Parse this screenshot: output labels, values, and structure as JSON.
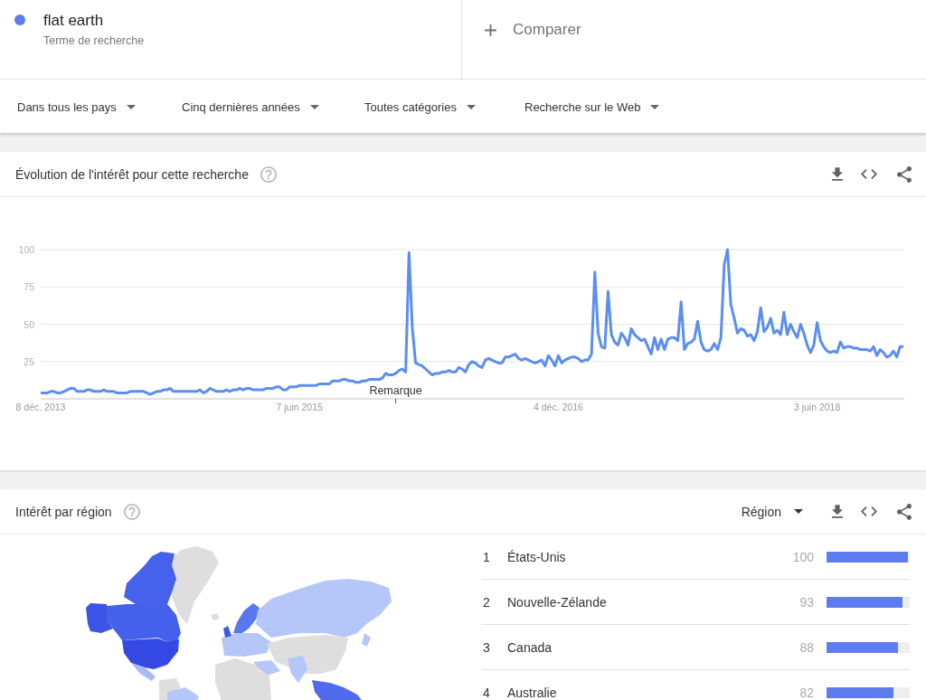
{
  "search_term": {
    "term": "flat earth",
    "caption": "Terme de recherche"
  },
  "compare": {
    "label": "Comparer"
  },
  "filters": [
    "Dans tous les pays",
    "Cinq dernières années",
    "Toutes catégories",
    "Recherche sur le Web"
  ],
  "interest_over_time": {
    "title": "Évolution de l'intérêt pour cette recherche",
    "chart_data": {
      "type": "line",
      "categories": [
        "8 déc. 2013",
        null,
        null,
        null,
        null,
        null,
        null,
        null,
        null,
        null,
        null,
        null,
        null,
        null,
        null,
        null,
        null,
        null,
        null,
        null,
        null,
        null,
        null,
        null,
        null,
        null,
        null,
        null,
        null,
        null,
        null,
        null,
        null,
        null,
        null,
        null,
        null,
        null,
        null,
        null,
        null,
        null,
        null,
        null,
        null,
        null,
        null,
        null,
        null,
        null,
        null,
        null,
        null,
        null,
        null,
        null,
        null,
        null,
        null,
        null,
        null,
        null,
        null,
        null,
        null,
        null,
        null,
        null,
        null,
        null,
        null,
        null,
        null,
        null,
        null,
        null,
        null,
        null,
        "7 juin 2015",
        null,
        null,
        null,
        null,
        null,
        null,
        null,
        null,
        null,
        null,
        null,
        null,
        null,
        null,
        null,
        null,
        null,
        null,
        null,
        null,
        null,
        null,
        null,
        null,
        null,
        null,
        null,
        null,
        null,
        null,
        null,
        null,
        null,
        null,
        null,
        null,
        null,
        null,
        null,
        null,
        null,
        null,
        null,
        null,
        null,
        null,
        null,
        null,
        null,
        null,
        null,
        null,
        null,
        null,
        null,
        null,
        null,
        null,
        null,
        null,
        null,
        null,
        null,
        null,
        null,
        null,
        null,
        null,
        null,
        null,
        null,
        null,
        null,
        null,
        null,
        null,
        null,
        "4 déc. 2016",
        null,
        null,
        null,
        null,
        null,
        null,
        null,
        null,
        null,
        null,
        null,
        null,
        null,
        null,
        null,
        null,
        null,
        null,
        null,
        null,
        null,
        null,
        null,
        null,
        null,
        null,
        null,
        null,
        null,
        null,
        null,
        null,
        null,
        null,
        null,
        null,
        null,
        null,
        null,
        null,
        null,
        null,
        null,
        null,
        null,
        null,
        null,
        null,
        null,
        null,
        null,
        null,
        null,
        null,
        null,
        null,
        null,
        null,
        null,
        null,
        null,
        null,
        null,
        null,
        null,
        null,
        null,
        null,
        null,
        null,
        null,
        null,
        null,
        null,
        null,
        null,
        null,
        "3 juin 2018",
        null,
        null,
        null,
        null,
        null,
        null,
        null,
        null,
        null,
        null,
        null,
        null,
        null,
        null,
        null,
        null,
        null,
        null,
        null,
        null,
        null,
        null,
        null,
        null,
        null,
        null
      ],
      "series": [
        {
          "color": "#5b8ef1",
          "values": [
            4,
            4,
            4,
            5,
            5,
            4,
            4,
            5,
            6,
            7,
            7,
            5,
            5,
            5,
            6,
            6,
            5,
            5,
            5,
            6,
            5,
            5,
            5,
            4,
            4,
            4,
            4,
            5,
            5,
            5,
            5,
            5,
            4,
            3,
            4,
            5,
            5,
            6,
            6,
            7,
            5,
            5,
            5,
            5,
            5,
            5,
            5,
            5,
            6,
            4,
            5,
            7,
            6,
            5,
            5,
            5,
            6,
            5,
            6,
            6,
            7,
            6,
            7,
            7,
            6,
            6,
            6,
            6,
            7,
            7,
            7,
            8,
            8,
            6,
            6,
            8,
            8,
            8,
            9,
            9,
            9,
            9,
            9,
            9,
            10,
            10,
            10,
            10,
            12,
            12,
            12,
            13,
            13,
            12,
            12,
            11,
            11,
            12,
            12,
            13,
            13,
            13,
            13,
            14,
            17,
            16,
            16,
            17,
            19,
            20,
            18,
            98,
            47,
            24,
            23,
            22,
            20,
            18,
            16,
            17,
            17,
            18,
            18,
            19,
            18,
            18,
            21,
            20,
            18,
            23,
            25,
            24,
            22,
            21,
            26,
            27,
            26,
            25,
            24,
            24,
            28,
            28,
            29,
            30,
            27,
            26,
            27,
            26,
            25,
            24,
            25,
            26,
            22,
            29,
            26,
            22,
            29,
            24,
            26,
            27,
            28,
            28,
            27,
            25,
            26,
            26,
            30,
            85,
            44,
            35,
            34,
            72,
            43,
            38,
            36,
            44,
            41,
            36,
            47,
            43,
            41,
            39,
            40,
            35,
            30,
            41,
            33,
            40,
            33,
            40,
            41,
            41,
            39,
            65,
            33,
            37,
            38,
            40,
            52,
            38,
            33,
            32,
            33,
            37,
            33,
            41,
            90,
            100,
            63,
            54,
            44,
            47,
            46,
            42,
            43,
            39,
            45,
            61,
            45,
            48,
            54,
            44,
            46,
            43,
            58,
            43,
            50,
            45,
            41,
            50,
            44,
            36,
            31,
            36,
            51,
            39,
            35,
            32,
            31,
            32,
            31,
            38,
            34,
            35,
            35,
            34,
            34,
            33,
            33,
            33,
            32,
            35,
            29,
            33,
            31,
            28,
            29,
            32,
            28,
            35,
            35
          ]
        }
      ],
      "ylim": [
        0,
        100
      ],
      "yticks": [
        25,
        50,
        75,
        100
      ],
      "grid": true,
      "annotations": [
        "Remarque"
      ]
    }
  },
  "interest_by_region": {
    "title": "Intérêt par région",
    "resolution": "Région",
    "regions": [
      {
        "rank": "1",
        "name": "États-Unis",
        "score": "100",
        "level": 1.0
      },
      {
        "rank": "2",
        "name": "Nouvelle-Zélande",
        "score": "93",
        "level": 0.93
      },
      {
        "rank": "3",
        "name": "Canada",
        "score": "88",
        "level": 0.88
      },
      {
        "rank": "4",
        "name": "Australie",
        "score": "82",
        "level": 0.82
      }
    ]
  }
}
